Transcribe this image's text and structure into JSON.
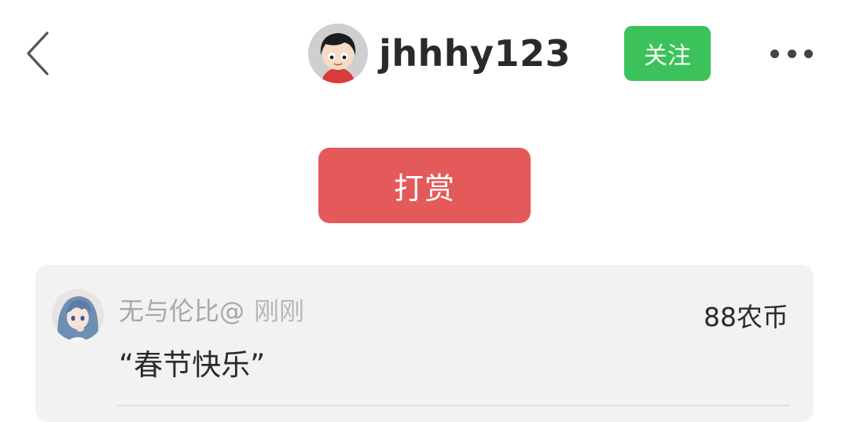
{
  "header": {
    "username": "jhhhy123",
    "follow_label": "关注",
    "icons": {
      "back": "chevron-left-icon",
      "more": "more-horizontal-icon"
    }
  },
  "reward": {
    "button_label": "打赏"
  },
  "rewards": [
    {
      "name": "无与伦比@",
      "time": "刚刚",
      "amount": "88农币",
      "message": "“春节快乐”"
    }
  ],
  "colors": {
    "follow_green": "#3cc25a",
    "reward_red": "#e45a5a",
    "list_bg": "#f2f2f2",
    "muted_text": "#a8a8a8"
  }
}
